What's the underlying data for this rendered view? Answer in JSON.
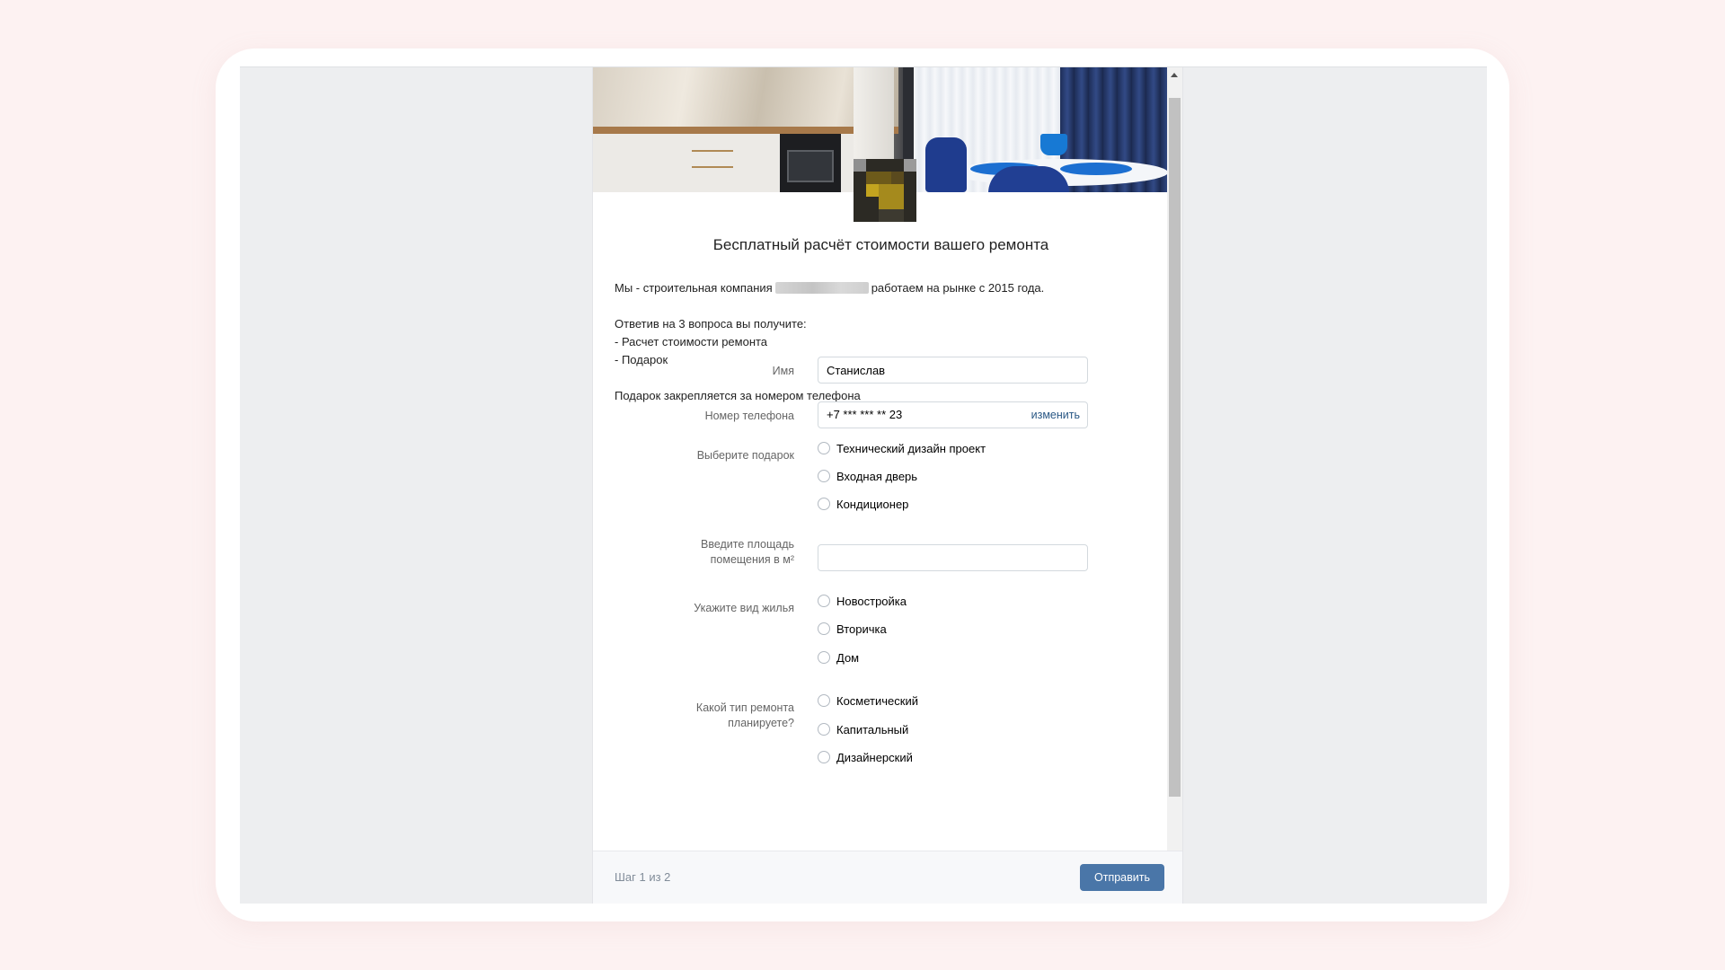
{
  "form": {
    "title": "Бесплатный расчёт стоимости вашего ремонта",
    "description": {
      "line1_before": "Мы - строительная компания",
      "line1_after": "работаем на рынке с 2015 года.",
      "line2": "Ответив на 3 вопроса вы получите:",
      "line3": "- Расчет стоимости ремонта",
      "line4": "- Подарок",
      "line5": "Подарок закрепляется за номером телефона"
    },
    "fields": {
      "name": {
        "label": "Имя",
        "value": "Станислав"
      },
      "phone": {
        "label": "Номер телефона",
        "value": "+7 *** *** ** 23",
        "change_label": "изменить"
      },
      "gift": {
        "label": "Выберите подарок",
        "options": [
          "Технический дизайн проект",
          "Входная дверь",
          "Кондиционер"
        ]
      },
      "area": {
        "label_line1": "Введите площадь",
        "label_line2": "помещения в м²",
        "value": ""
      },
      "housing": {
        "label": "Укажите вид жилья",
        "options": [
          "Новостройка",
          "Вторичка",
          "Дом"
        ]
      },
      "repair": {
        "label_line1": "Какой тип ремонта",
        "label_line2": "планируете?",
        "options": [
          "Косметический",
          "Капитальный",
          "Дизайнерский"
        ]
      }
    }
  },
  "footer": {
    "step": "Шаг 1 из 2",
    "submit_label": "Отправить"
  },
  "colors": {
    "accent": "#4a76a8",
    "link": "#2a5885",
    "page_background": "#fdf2f2",
    "screen_background": "#edeef0"
  }
}
